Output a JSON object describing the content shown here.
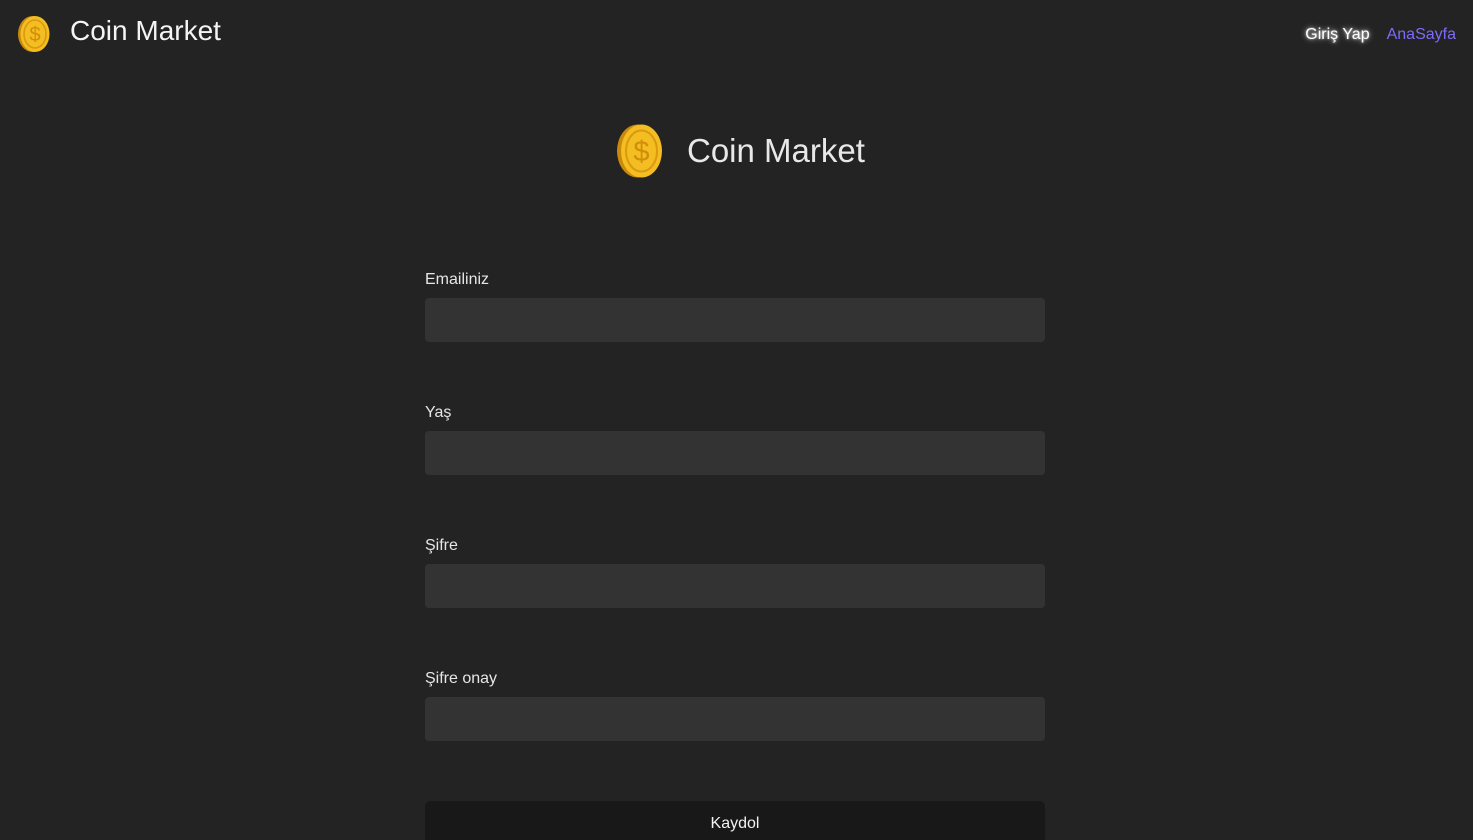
{
  "brand": {
    "name": "Coin Market",
    "logo_icon": "coin-dollar-icon",
    "coin_color": "#f2b61b"
  },
  "nav": {
    "login_label": "Giriş Yap",
    "home_label": "AnaSayfa",
    "home_color": "#7b6cf6"
  },
  "hero": {
    "title": "Coin Market"
  },
  "form": {
    "email_label": "Emailiniz",
    "email_value": "",
    "age_label": "Yaş",
    "age_value": "",
    "password_label": "Şifre",
    "password_value": "",
    "password_confirm_label": "Şifre onay",
    "password_confirm_value": "",
    "submit_label": "Kaydol"
  }
}
